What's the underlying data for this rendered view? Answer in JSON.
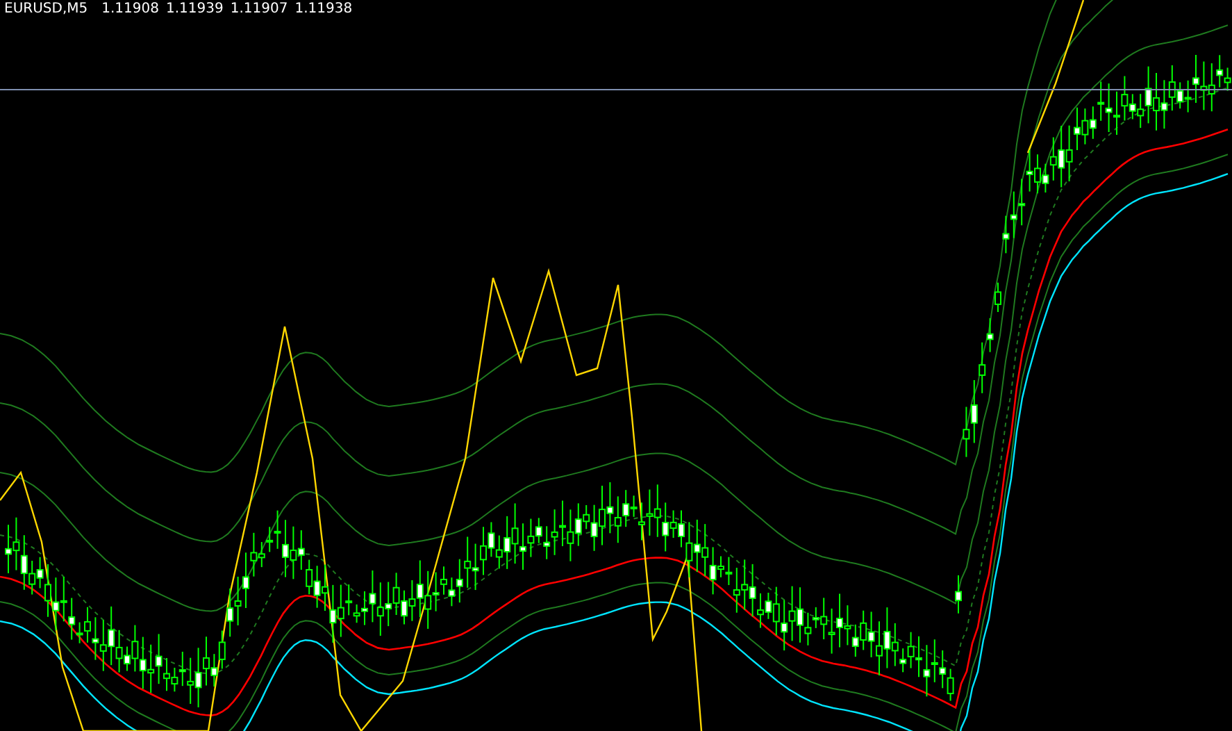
{
  "chart": {
    "symbol": "EURUSD,M5",
    "prices": [
      "1.11908",
      "1.11939",
      "1.11907",
      "1.11938"
    ]
  }
}
